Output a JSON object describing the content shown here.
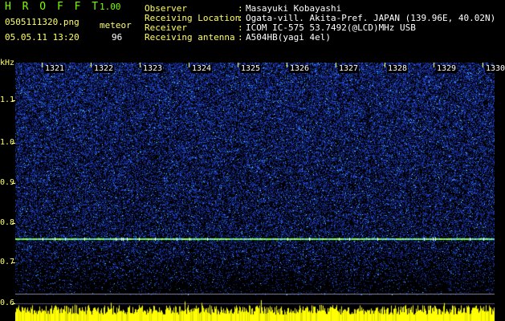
{
  "header": {
    "app_name": "HROFFT",
    "version": "1.00",
    "filename": "0505111320.png",
    "datetime": "05.05.11 13:20",
    "mode_label": "meteor",
    "count": "96",
    "info": [
      {
        "key": "Observer",
        "value": "Masayuki Kobayashi"
      },
      {
        "key": "Receiving Location",
        "value": "Ogata-vill. Akita-Pref. JAPAN (139.96E, 40.02N)"
      },
      {
        "key": "Receiver",
        "value": "ICOM IC-575 53.7492(@LCD)MHz USB"
      },
      {
        "key": "Receiving antenna",
        "value": "A504HB(yagi 4el)"
      }
    ]
  },
  "chart_data": {
    "type": "heatmap",
    "ylabel": "kHz",
    "y_ticks": [
      "1.1",
      "1.0",
      "0.9",
      "0.8",
      "0.7",
      "0.6"
    ],
    "x_ticks": [
      "1321",
      "1322",
      "1323",
      "1324",
      "1325",
      "1326",
      "1327",
      "1328",
      "1329",
      "1330"
    ],
    "carrier_line_khz": 0.76,
    "colors": {
      "background": "#000000",
      "noise": "#1e2fa8",
      "signal": "#7cff3a",
      "hot": "#ffffff",
      "level": "#ffff00"
    }
  }
}
